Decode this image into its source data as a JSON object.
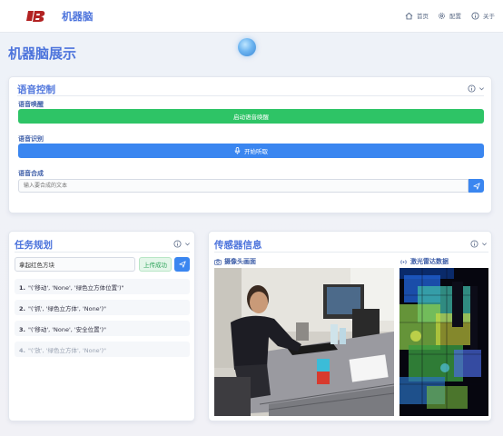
{
  "header": {
    "logo_text": "IB",
    "app_title": "机器脑",
    "nav": [
      {
        "label": "首页",
        "icon": "home-icon"
      },
      {
        "label": "配置",
        "icon": "gear-icon"
      },
      {
        "label": "关于",
        "icon": "info-icon"
      }
    ]
  },
  "page_title": "机器脑展示",
  "voice": {
    "title": "语音控制",
    "wake_label": "语音唤醒",
    "wake_button": "启动语音唤醒",
    "asr_label": "语音识别",
    "asr_button": "开始听取",
    "tts_label": "语音合成",
    "tts_placeholder": "输入要合成的文本"
  },
  "tasks": {
    "title": "任务规划",
    "input_value": "拿起红色方块",
    "upload_status": "上传成功",
    "items": [
      {
        "num": "1.",
        "text": "\"('移动', 'None', '绿色立方体位置')\"",
        "done": false
      },
      {
        "num": "2.",
        "text": "\"('抓', '绿色立方体', 'None')\"",
        "done": false
      },
      {
        "num": "3.",
        "text": "\"('移动', 'None', '安全位置')\"",
        "done": false
      },
      {
        "num": "4.",
        "text": "\"('放', '绿色立方体', 'None')\"",
        "done": true
      }
    ]
  },
  "sensors": {
    "title": "传感器信息",
    "camera_label": "摄像头画面",
    "lidar_label": "激光雷达数据"
  },
  "colors": {
    "accent": "#4d74dc",
    "green": "#2ec466",
    "blue": "#3a86f0"
  }
}
